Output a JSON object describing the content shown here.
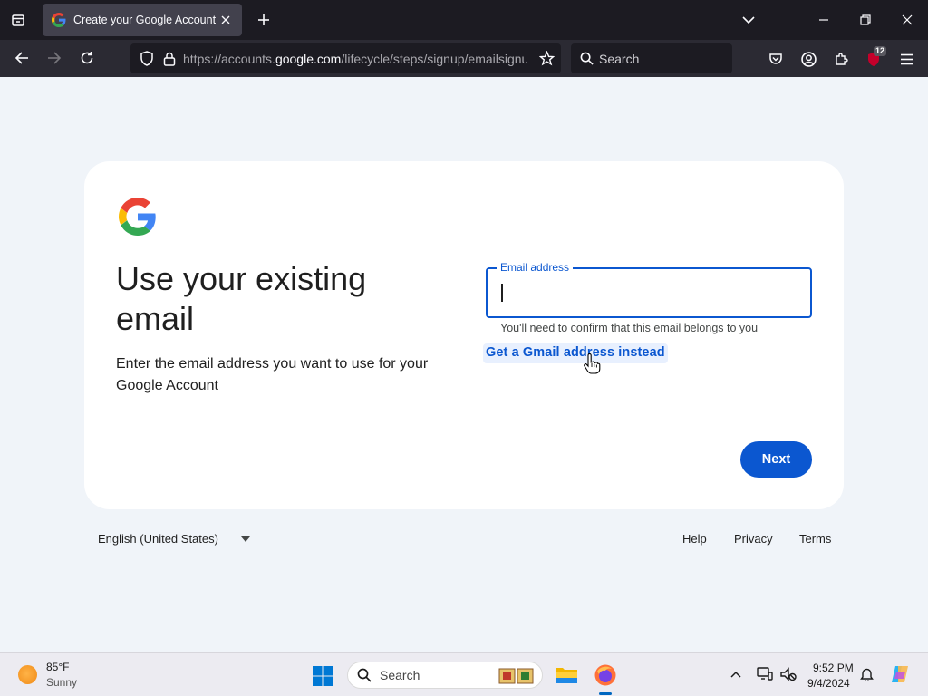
{
  "browser": {
    "tab": {
      "title": "Create your Google Account"
    },
    "url": {
      "prefix": "https://accounts.",
      "host": "google.com",
      "path": "/lifecycle/steps/signup/emailsignu"
    },
    "search_placeholder": "Search",
    "extension_badge": "12"
  },
  "page": {
    "heading": "Use your existing email",
    "subtext": "Enter the email address you want to use for your Google Account",
    "email_field": {
      "label": "Email address",
      "value": ""
    },
    "helper_text": "You'll need to confirm that this email belongs to you",
    "gmail_link": "Get a Gmail address instead",
    "next_button": "Next"
  },
  "footer": {
    "language": "English (United States)",
    "links": {
      "help": "Help",
      "privacy": "Privacy",
      "terms": "Terms"
    }
  },
  "taskbar": {
    "weather": {
      "temp": "85°F",
      "condition": "Sunny"
    },
    "search_placeholder": "Search",
    "clock": {
      "time": "9:52 PM",
      "date": "9/4/2024"
    }
  },
  "colors": {
    "primary": "#0b57d0",
    "page_bg": "#f0f4f9",
    "tab_bar": "#1c1b22",
    "nav_bar": "#2b2a33"
  }
}
